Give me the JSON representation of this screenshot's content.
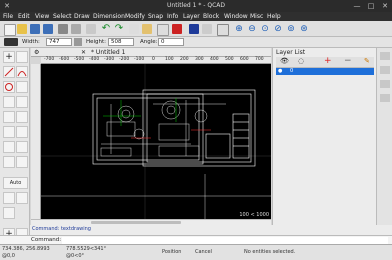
{
  "window": {
    "title": "Untitled 1 * - QCAD"
  },
  "menu": [
    "File",
    "Edit",
    "View",
    "Select",
    "Draw",
    "Dimension",
    "Modify",
    "Snap",
    "Info",
    "Layer",
    "Block",
    "Window",
    "Misc",
    "Help"
  ],
  "options_bar": {
    "width_label": "Width:",
    "width_value": "747",
    "height_label": "Height:",
    "height_value": "508",
    "angle_label": "Angle:",
    "angle_value": "0"
  },
  "document": {
    "tab_label": "Untitled 1"
  },
  "ruler": {
    "ticks": [
      "-700",
      "-600",
      "-500",
      "-400",
      "-300",
      "-200",
      "-100",
      "0",
      "100",
      "200",
      "300",
      "400",
      "500",
      "600",
      "700"
    ]
  },
  "canvas": {
    "grid_info": "100 < 1000"
  },
  "layer_list": {
    "title": "Layer List",
    "layers": [
      {
        "name": "0"
      }
    ]
  },
  "command": {
    "prompt_label": "Command:",
    "history_text": "Command: textdrawing"
  },
  "status": {
    "abs_coords": "734.386, 256.8993",
    "rel_coords": "@0,0",
    "polar_coords": "778.5529<341°",
    "polar_rel": "@0<0°",
    "mouse_left": "Position",
    "mouse_right": "Cancel",
    "selection": "No entities selected."
  },
  "colors": {
    "accent": "#1e6fd9",
    "canvas_bg": "#000000",
    "drawing": "#ffffff",
    "menu_bg": "#2f2f2f"
  }
}
